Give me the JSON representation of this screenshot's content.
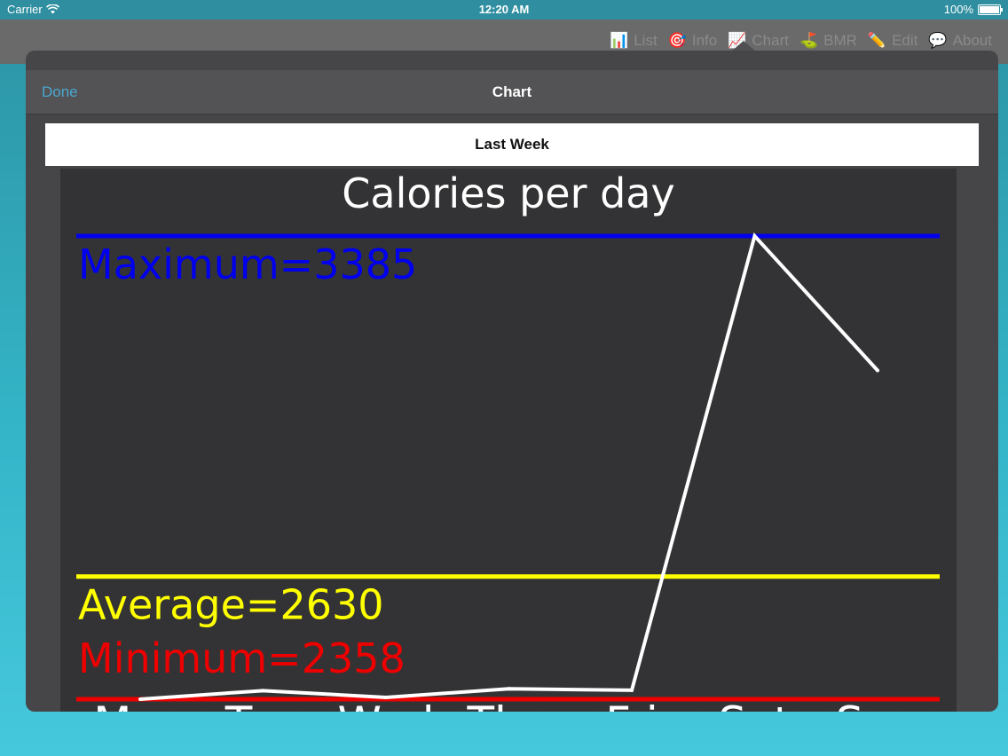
{
  "status_bar": {
    "carrier": "Carrier",
    "time": "12:20 AM",
    "battery": "100%"
  },
  "toolbar": {
    "items": [
      {
        "icon": "bar-chart-icon",
        "glyph": "📊",
        "label": "List"
      },
      {
        "icon": "target-icon",
        "glyph": "🎯",
        "label": "Info"
      },
      {
        "icon": "line-chart-icon",
        "glyph": "📈",
        "label": "Chart"
      },
      {
        "icon": "golf-icon",
        "glyph": "⛳",
        "label": "BMR"
      },
      {
        "icon": "pencil-icon",
        "glyph": "✏️",
        "label": "Edit"
      },
      {
        "icon": "speech-bubble-icon",
        "glyph": "💬",
        "label": "About"
      }
    ]
  },
  "popover": {
    "done_label": "Done",
    "title": "Chart",
    "segment_label": "Last Week"
  },
  "chart_data": {
    "type": "line",
    "title": "Calories per day",
    "categories": [
      "Mon",
      "Tue",
      "Wed",
      "Thu",
      "Fri",
      "Sat",
      "Sun"
    ],
    "series": [
      {
        "values": [
          2358,
          2377,
          2362,
          2381,
          2378,
          3385,
          3087
        ]
      }
    ],
    "reference_lines": [
      {
        "label": "Maximum=3385",
        "value": 3385,
        "color": "#0000ee"
      },
      {
        "label": "Average=2630",
        "value": 2630,
        "color": "#ffff00"
      },
      {
        "label": "Minimum=2358",
        "value": 2358,
        "color": "#ee0000"
      }
    ],
    "ylim": [
      2358,
      3385
    ],
    "line_color": "#ffffff",
    "grid": false
  }
}
